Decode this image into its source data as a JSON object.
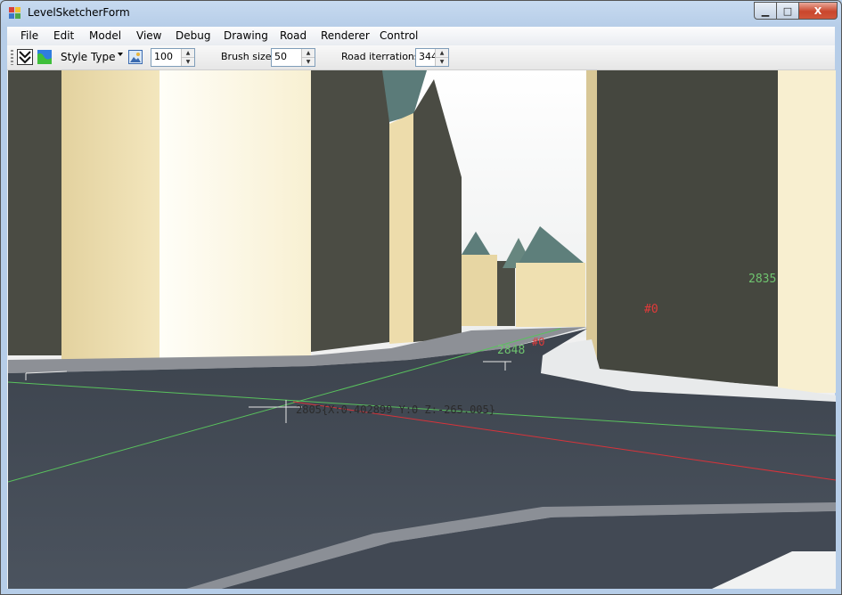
{
  "window": {
    "title": "LevelSketcherForm"
  },
  "window_controls": {
    "minimize": "▁",
    "maximize": "□",
    "close": "X"
  },
  "menu": {
    "file": "File",
    "edit": "Edit",
    "model": "Model",
    "view": "View",
    "debug": "Debug",
    "drawing": "Drawing",
    "road": "Road",
    "renderer": "Renderer",
    "control": "Control"
  },
  "toolbar": {
    "style_type": "Style Type",
    "zoom_value": "100",
    "brush_size_label": "Brush size",
    "brush_size_value": "50",
    "road_iterations_label": "Road iterrations",
    "road_iterations_value": "344"
  },
  "scene": {
    "labels": {
      "node_2835": "2835",
      "node_0": "#0",
      "node_2848": "2848",
      "node_hash_red": "#0",
      "cursor_readout": "2805{X:0.402899 Y:0 Z:-265.005}"
    },
    "colors": {
      "sky": "#f5f6f6",
      "road": "#3f4651",
      "building_wall": "#efe0b1",
      "building_dark": "#45473f",
      "roof": "#5b7b79",
      "axis_green": "#59c25d",
      "axis_red": "#d8333a",
      "label_green": "#6fc46f",
      "label_red": "#e23a3a"
    }
  }
}
